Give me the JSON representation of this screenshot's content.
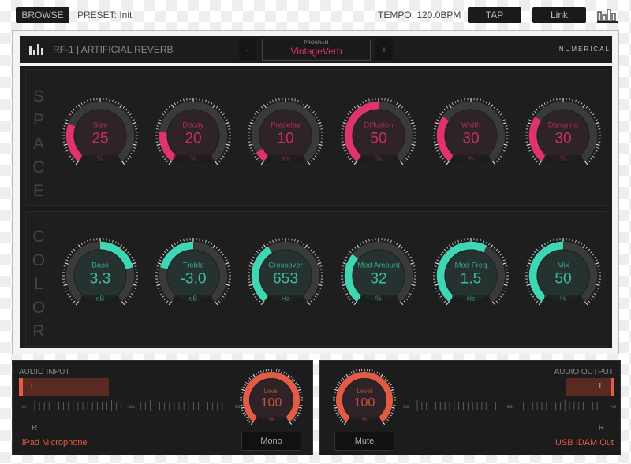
{
  "topbar": {
    "browse": "BROWSE",
    "preset": "PRESET: Init",
    "tempo": "TEMPO: 120.0BPM",
    "tap": "TAP",
    "link": "Link"
  },
  "header": {
    "title": "RF-1 | ARTIFICIAL REVERB",
    "program_label": "PROGRAM",
    "program": "VintageVerb",
    "minus": "-",
    "plus": "+",
    "brand": "NUMERICAL"
  },
  "colors": {
    "space": "#e0336a",
    "color": "#3fd6b4",
    "level": "#e35a45"
  },
  "space": {
    "label": [
      "S",
      "P",
      "A",
      "C",
      "E"
    ],
    "knobs": [
      {
        "name": "Size",
        "value": "25",
        "unit": "%",
        "fraction": 0.25
      },
      {
        "name": "Decay",
        "value": "20",
        "unit": "%",
        "fraction": 0.2
      },
      {
        "name": "Predelay",
        "value": "10",
        "unit": "ms",
        "fraction": 0.07
      },
      {
        "name": "Diffusion",
        "value": "50",
        "unit": "%",
        "fraction": 0.5
      },
      {
        "name": "Width",
        "value": "30",
        "unit": "%",
        "fraction": 0.3
      },
      {
        "name": "Damping",
        "value": "30",
        "unit": "%",
        "fraction": 0.3
      }
    ]
  },
  "color": {
    "label": [
      "C",
      "O",
      "L",
      "O",
      "R"
    ],
    "knobs": [
      {
        "name": "Bass",
        "value": "3.3",
        "unit": "dB",
        "fraction": 0.77,
        "bipolar": true
      },
      {
        "name": "Treble",
        "value": "-3.0",
        "unit": "dB",
        "fraction": 0.23,
        "bipolar": true
      },
      {
        "name": "Crossover",
        "value": "653",
        "unit": "Hz",
        "fraction": 0.39
      },
      {
        "name": "Mod Amount",
        "value": "32",
        "unit": "%",
        "fraction": 0.32
      },
      {
        "name": "Mod Freq",
        "value": "1.5",
        "unit": "Hz",
        "fraction": 0.6
      },
      {
        "name": "Mix",
        "value": "50",
        "unit": "%",
        "fraction": 0.5
      }
    ]
  },
  "input": {
    "title": "AUDIO INPUT",
    "left": "L",
    "right": "R",
    "scale": [
      "-inf",
      "-6db",
      "0db"
    ],
    "device": "iPad Microphone",
    "level": {
      "name": "Level",
      "value": "100",
      "unit": "%",
      "fraction": 1
    },
    "button": "Mono"
  },
  "output": {
    "title": "AUDIO OUTPUT",
    "left": "L",
    "right": "R",
    "scale": [
      "0db",
      "-6db",
      "-inf"
    ],
    "device": "USB IDAM Out",
    "level": {
      "name": "Level",
      "value": "100",
      "unit": "%",
      "fraction": 1
    },
    "button": "Mute"
  }
}
